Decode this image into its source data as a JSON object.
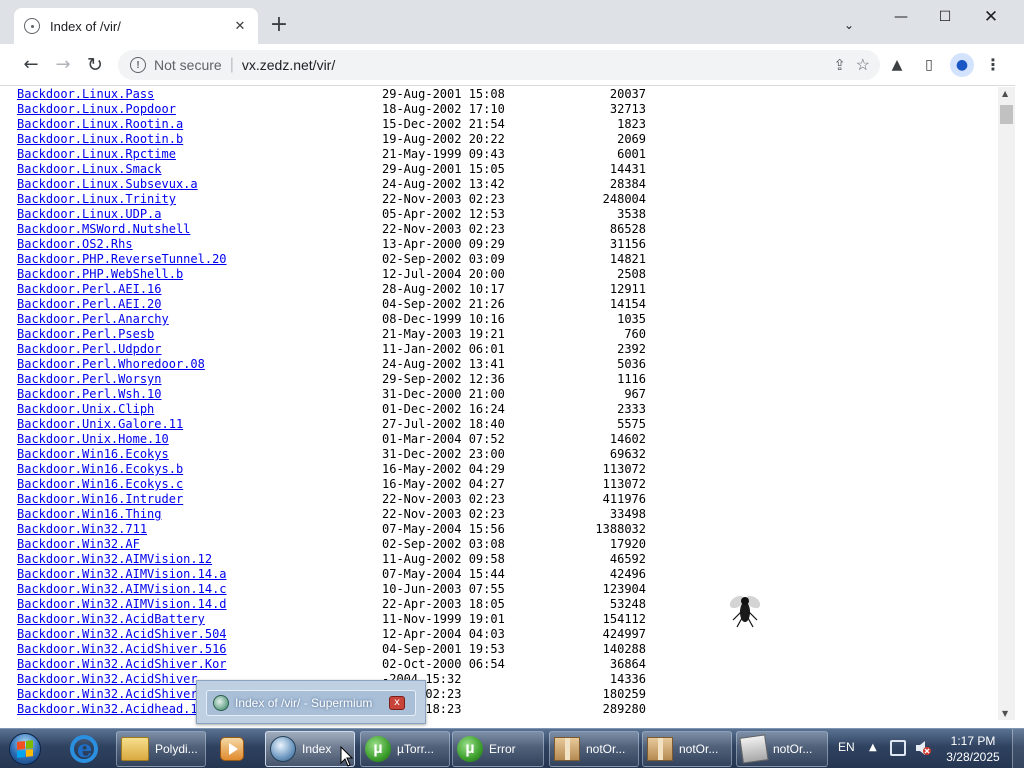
{
  "browser": {
    "tab_title": "Index of /vir/",
    "tab_close": "✕",
    "new_tab": "+",
    "tab_search": "⌄",
    "minimize": "—",
    "maximize": "☐",
    "close": "✕",
    "security_label": "Not secure",
    "url": "vx.zedz.net/vir/",
    "back": "←",
    "forward": "→",
    "reload": "↻",
    "share": "⇪",
    "star": "☆",
    "extensions": "▲",
    "sidepanel": "▯",
    "profile": "●",
    "menu": "⋮"
  },
  "listing": [
    {
      "name": "Backdoor.Linux.Pass",
      "date": "29-Aug-2001 15:08",
      "size": "20037"
    },
    {
      "name": "Backdoor.Linux.Popdoor",
      "date": "18-Aug-2002 17:10",
      "size": "32713"
    },
    {
      "name": "Backdoor.Linux.Rootin.a",
      "date": "15-Dec-2002 21:54",
      "size": "1823"
    },
    {
      "name": "Backdoor.Linux.Rootin.b",
      "date": "19-Aug-2002 20:22",
      "size": "2069"
    },
    {
      "name": "Backdoor.Linux.Rpctime",
      "date": "21-May-1999 09:43",
      "size": "6001"
    },
    {
      "name": "Backdoor.Linux.Smack",
      "date": "29-Aug-2001 15:05",
      "size": "14431"
    },
    {
      "name": "Backdoor.Linux.Subsevux.a",
      "date": "24-Aug-2002 13:42",
      "size": "28384"
    },
    {
      "name": "Backdoor.Linux.Trinity",
      "date": "22-Nov-2003 02:23",
      "size": "248004"
    },
    {
      "name": "Backdoor.Linux.UDP.a",
      "date": "05-Apr-2002 12:53",
      "size": "3538"
    },
    {
      "name": "Backdoor.MSWord.Nutshell",
      "date": "22-Nov-2003 02:23",
      "size": "86528"
    },
    {
      "name": "Backdoor.OS2.Rhs",
      "date": "13-Apr-2000 09:29",
      "size": "31156"
    },
    {
      "name": "Backdoor.PHP.ReverseTunnel.20",
      "date": "02-Sep-2002 03:09",
      "size": "14821"
    },
    {
      "name": "Backdoor.PHP.WebShell.b",
      "date": "12-Jul-2004 20:00",
      "size": "2508"
    },
    {
      "name": "Backdoor.Perl.AEI.16",
      "date": "28-Aug-2002 10:17",
      "size": "12911"
    },
    {
      "name": "Backdoor.Perl.AEI.20",
      "date": "04-Sep-2002 21:26",
      "size": "14154"
    },
    {
      "name": "Backdoor.Perl.Anarchy",
      "date": "08-Dec-1999 10:16",
      "size": "1035"
    },
    {
      "name": "Backdoor.Perl.Psesb",
      "date": "21-May-2003 19:21",
      "size": "760"
    },
    {
      "name": "Backdoor.Perl.Udpdor",
      "date": "11-Jan-2002 06:01",
      "size": "2392"
    },
    {
      "name": "Backdoor.Perl.Whoredoor.08",
      "date": "24-Aug-2002 13:41",
      "size": "5036"
    },
    {
      "name": "Backdoor.Perl.Worsyn",
      "date": "29-Sep-2002 12:36",
      "size": "1116"
    },
    {
      "name": "Backdoor.Perl.Wsh.10",
      "date": "31-Dec-2000 21:00",
      "size": "967"
    },
    {
      "name": "Backdoor.Unix.Cliph",
      "date": "01-Dec-2002 16:24",
      "size": "2333"
    },
    {
      "name": "Backdoor.Unix.Galore.11",
      "date": "27-Jul-2002 18:40",
      "size": "5575"
    },
    {
      "name": "Backdoor.Unix.Home.10",
      "date": "01-Mar-2004 07:52",
      "size": "14602"
    },
    {
      "name": "Backdoor.Win16.Ecokys",
      "date": "31-Dec-2002 23:00",
      "size": "69632"
    },
    {
      "name": "Backdoor.Win16.Ecokys.b",
      "date": "16-May-2002 04:29",
      "size": "113072"
    },
    {
      "name": "Backdoor.Win16.Ecokys.c",
      "date": "16-May-2002 04:27",
      "size": "113072"
    },
    {
      "name": "Backdoor.Win16.Intruder",
      "date": "22-Nov-2003 02:23",
      "size": "411976"
    },
    {
      "name": "Backdoor.Win16.Thing",
      "date": "22-Nov-2003 02:23",
      "size": "33498"
    },
    {
      "name": "Backdoor.Win32.711",
      "date": "07-May-2004 15:56",
      "size": "1388032"
    },
    {
      "name": "Backdoor.Win32.AF",
      "date": "02-Sep-2002 03:08",
      "size": "17920"
    },
    {
      "name": "Backdoor.Win32.AIMVision.12",
      "date": "11-Aug-2002 09:58",
      "size": "46592"
    },
    {
      "name": "Backdoor.Win32.AIMVision.14.a",
      "date": "07-May-2004 15:44",
      "size": "42496"
    },
    {
      "name": "Backdoor.Win32.AIMVision.14.c",
      "date": "10-Jun-2003 07:55",
      "size": "123904"
    },
    {
      "name": "Backdoor.Win32.AIMVision.14.d",
      "date": "22-Apr-2003 18:05",
      "size": "53248"
    },
    {
      "name": "Backdoor.Win32.AcidBattery",
      "date": "11-Nov-1999 19:01",
      "size": "154112"
    },
    {
      "name": "Backdoor.Win32.AcidShiver.504",
      "date": "12-Apr-2004 04:03",
      "size": "424997"
    },
    {
      "name": "Backdoor.Win32.AcidShiver.516",
      "date": "04-Sep-2001 19:53",
      "size": "140288"
    },
    {
      "name": "Backdoor.Win32.AcidShiver.Kor",
      "date": "02-Oct-2000 06:54",
      "size": "36864"
    },
    {
      "name": "Backdoor.Win32.AcidShiver",
      "date": "-2004 15:32",
      "size": "14336"
    },
    {
      "name": "Backdoor.Win32.AcidShiver",
      "date": "-2003 02:23",
      "size": "180259"
    },
    {
      "name": "Backdoor.Win32.Acidhead.1",
      "date": "-2002 18:23",
      "size": "289280"
    }
  ],
  "preview": {
    "title": "Index of /vir/ - Supermium",
    "close": "x"
  },
  "taskbar": {
    "items": [
      {
        "label": "Polydi..."
      },
      {
        "label": "Index"
      },
      {
        "label": "µTorr..."
      },
      {
        "label": "Error"
      },
      {
        "label": "notOr..."
      },
      {
        "label": "notOr..."
      },
      {
        "label": "notOr..."
      }
    ],
    "language": "EN",
    "tray_arrow": "▲",
    "time": "1:17 PM",
    "date": "3/28/2025"
  },
  "colors": {
    "link": "#0000ee",
    "tabstrip": "#dee1e6",
    "taskbar": "#2f4260"
  }
}
